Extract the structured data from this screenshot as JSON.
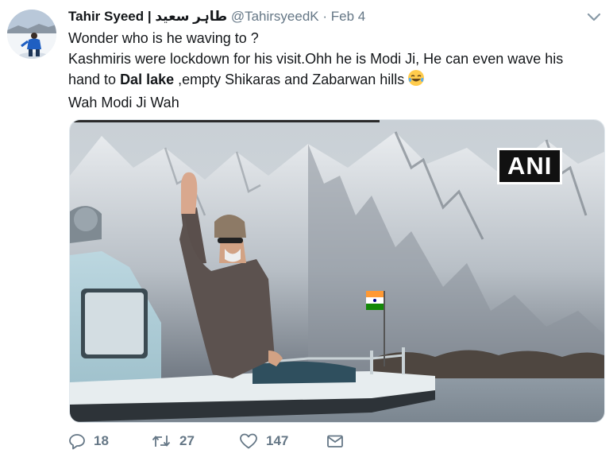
{
  "author": {
    "name": "Tahir Syeed",
    "separator": "|",
    "name_urdu": "طاہر سعید",
    "handle": "@TahirsyeedK",
    "dot": "·",
    "date": "Feb 4"
  },
  "tweet": {
    "line1": "Wonder who is he waving to ?",
    "line2_start": "Kashmiris were  lockdown for his visit.Ohh he is Modi Ji, He can even wave his",
    "line3_prefix": "hand to ",
    "line3_bold": "Dal lake",
    "line3_suffix": " ,empty Shikaras and Zabarwan hills",
    "line4": "Wah Modi Ji Wah"
  },
  "media": {
    "watermark": "ANI"
  },
  "actions": {
    "replies": "18",
    "retweets": "27",
    "likes": "147"
  },
  "icons": {
    "reply": "reply-icon",
    "retweet": "retweet-icon",
    "like": "heart-icon",
    "dm": "envelope-icon",
    "menu": "chevron-down-icon",
    "emoji": "face-with-tears-of-joy-emoji"
  },
  "colors": {
    "secondary_text": "#657786",
    "primary_text": "#14171a"
  }
}
